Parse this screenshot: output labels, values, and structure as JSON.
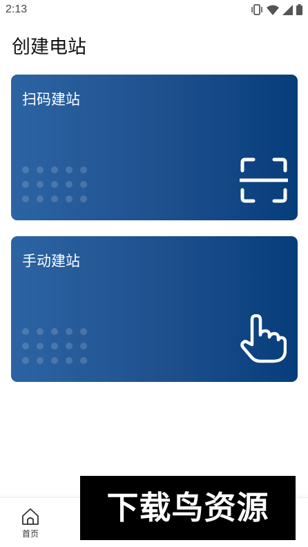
{
  "status_bar": {
    "time": "2:13",
    "icons": [
      "vibrate-icon",
      "wifi-icon",
      "signal-icon",
      "battery-icon"
    ]
  },
  "page": {
    "title": "创建电站"
  },
  "cards": [
    {
      "label": "扫码建站",
      "icon": "scan-icon"
    },
    {
      "label": "手动建站",
      "icon": "tap-hand-icon"
    }
  ],
  "bottom_nav": {
    "items": [
      {
        "label": "首页",
        "icon": "home-icon"
      },
      {
        "label": "",
        "icon": "tab-2-icon"
      },
      {
        "label": "",
        "icon": "tab-3-icon"
      },
      {
        "label": "",
        "icon": "tab-4-icon"
      }
    ]
  },
  "watermark": {
    "text": "下载鸟资源"
  },
  "colors": {
    "card_gradient_start": "#2c64a3",
    "card_gradient_end": "#063d7b",
    "card_text": "#ffffff"
  }
}
